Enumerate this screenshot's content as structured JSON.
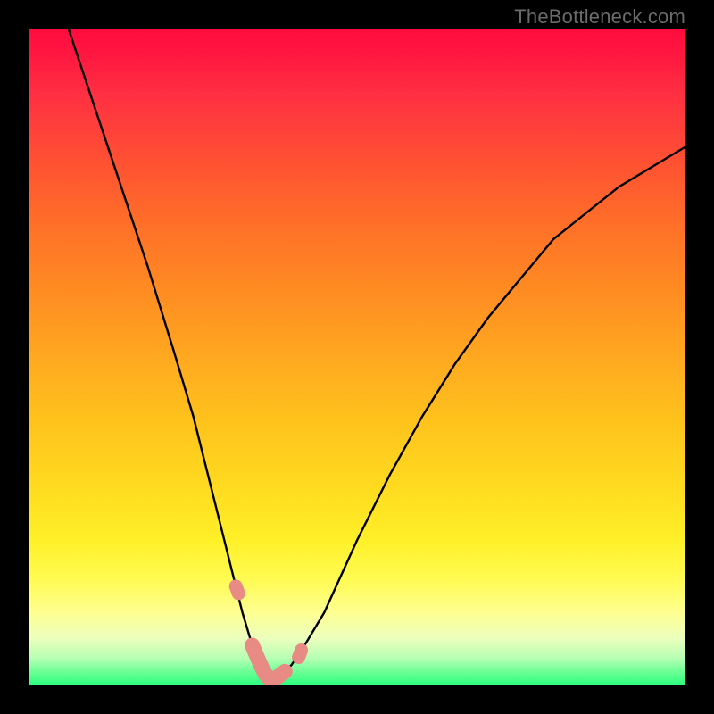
{
  "watermark": "TheBottleneck.com",
  "chart_data": {
    "type": "line",
    "title": "",
    "xlabel": "",
    "ylabel": "",
    "xlim": [
      0,
      100
    ],
    "ylim": [
      0,
      100
    ],
    "grid": false,
    "series": [
      {
        "name": "bottleneck-curve",
        "x": [
          6,
          10,
          14,
          18,
          22,
          25,
          27,
          29,
          31,
          32.5,
          34,
          35,
          36,
          37,
          38,
          40,
          42,
          45,
          50,
          55,
          60,
          65,
          70,
          75,
          80,
          85,
          90,
          95,
          100
        ],
        "y": [
          100,
          88,
          76,
          64,
          51,
          41,
          33,
          25,
          17,
          11,
          6,
          3,
          1,
          0.5,
          1,
          3,
          6,
          11,
          22,
          32,
          41,
          49,
          56,
          62,
          68,
          72,
          76,
          79,
          82
        ]
      }
    ],
    "annotations": [
      {
        "name": "flat-segment-marker",
        "x_range": [
          34,
          39
        ],
        "style": "pink-rounded"
      },
      {
        "name": "left-tick-marker",
        "x": 31.5,
        "style": "pink-dot"
      },
      {
        "name": "right-tick-marker",
        "x": 41.5,
        "style": "pink-dot"
      }
    ],
    "background": {
      "type": "vertical-gradient",
      "stops": [
        {
          "pos": 0.0,
          "color": "#ff0b3e"
        },
        {
          "pos": 0.5,
          "color": "#ffa820"
        },
        {
          "pos": 0.85,
          "color": "#fffb53"
        },
        {
          "pos": 1.0,
          "color": "#2eff80"
        }
      ]
    }
  }
}
